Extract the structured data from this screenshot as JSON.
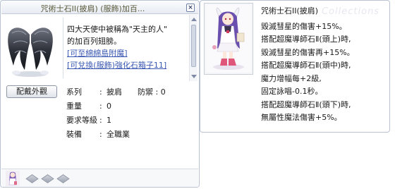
{
  "item_window": {
    "title": "咒術士石II(披肩) (服飾)加百...",
    "close_glyph": "×",
    "description": {
      "line1": "四大天使中被稱為\"天主的人\"",
      "line2": "的加百列翅膀。",
      "link1": "[可至綿綿島附魔]",
      "link2": "[可兌換(服飾)強化石箱子11]"
    },
    "equip_button": "配戴外觀",
    "properties": {
      "type_label": "系列",
      "type_value": "披肩",
      "defense_label": "防禦",
      "defense_value": "0",
      "weight_label": "重量",
      "weight_value": "0",
      "level_label": "要求等級",
      "level_value": "1",
      "equip_label": "裝備",
      "equip_value": "全職業",
      "separator": ":"
    }
  },
  "card_window": {
    "title": "咒術士石II(披肩)",
    "watermark": "Collections",
    "lines": [
      "毀滅彗星的傷害+15%。",
      "搭配超魔導師石Ⅱ(頭上)時,",
      "毀滅彗星的傷害再+15%。",
      "搭配超魔導師石Ⅱ(頭中)時,",
      "魔力增幅每+2級,",
      "固定詠唱-0.1秒。",
      "搭配超魔導師石Ⅱ(頭下)時,",
      "無屬性魔法傷害+5%。"
    ]
  },
  "colors": {
    "link": "#3a58b2",
    "window_border": "#b9c3d3",
    "title_text": "#5a5a3c"
  }
}
